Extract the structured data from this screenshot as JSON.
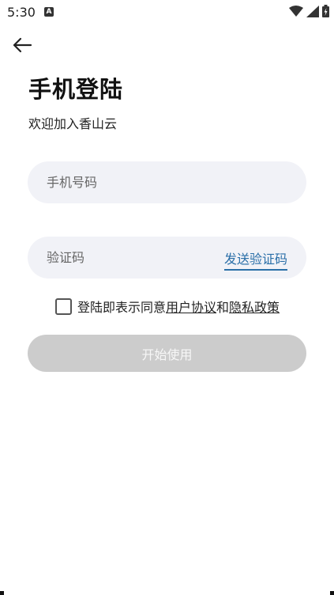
{
  "status_bar": {
    "time": "5:30",
    "notification_icon": "A",
    "icons": [
      "wifi-icon",
      "signal-icon",
      "battery-charging-icon"
    ]
  },
  "header": {
    "back_icon": "arrow-left-icon",
    "title": "手机登陆",
    "subtitle": "欢迎加入香山云"
  },
  "form": {
    "phone_placeholder": "手机号码",
    "code_placeholder": "验证码",
    "send_code_label": "发送验证码",
    "agreement_prefix": "登陆即表示同意",
    "user_agreement_label": "用户协议",
    "agreement_and": "和",
    "privacy_policy_label": "隐私政策",
    "agreement_checked": false,
    "start_button_label": "开始使用"
  },
  "colors": {
    "accent": "#2a6fa8",
    "field_bg": "#f1f2f7",
    "button_disabled": "#cccccc"
  }
}
